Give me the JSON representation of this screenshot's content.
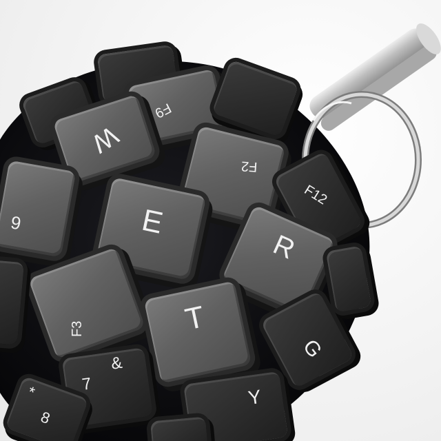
{
  "image": {
    "subject": "grenade made of keyboard keys",
    "colors": {
      "background": "#f2f2f2",
      "key": "#636363",
      "dark_key": "#2b2b2b",
      "metal": "#c9c9c9"
    },
    "keys": [
      {
        "id": "w",
        "label": "W"
      },
      {
        "id": "e",
        "label": "E"
      },
      {
        "id": "r",
        "label": "R"
      },
      {
        "id": "t",
        "label": "T"
      },
      {
        "id": "g",
        "label": "G"
      },
      {
        "id": "y",
        "label": "Y"
      },
      {
        "id": "f2",
        "label": "F2"
      },
      {
        "id": "f3",
        "label": "F3"
      },
      {
        "id": "f9",
        "label": "F9"
      },
      {
        "id": "f12",
        "label": "F12"
      },
      {
        "id": "nine",
        "label": "9"
      },
      {
        "id": "amp",
        "label": "&"
      },
      {
        "id": "seven",
        "label": "7"
      },
      {
        "id": "eight",
        "label": "8"
      },
      {
        "id": "star",
        "label": "*"
      }
    ]
  }
}
